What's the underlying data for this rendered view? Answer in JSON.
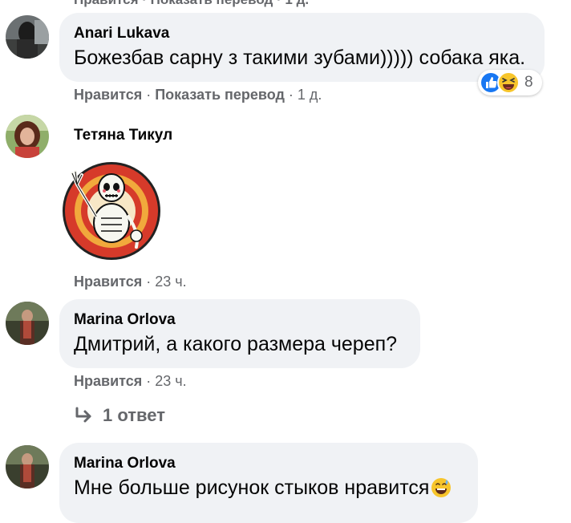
{
  "top_partial": {
    "text": "Нравится · Показать перевод · 1 д."
  },
  "comments": [
    {
      "author": "Anari Lukava",
      "text": "Божезбав сарну з такими зубами))))) собака яка.",
      "actions": {
        "like": "Нравится",
        "translate": "Показать перевод",
        "time": "1 д."
      },
      "reactions": {
        "icons": [
          "like-icon",
          "laughing-emoji-icon"
        ],
        "count": "8"
      }
    },
    {
      "author": "Тетяна Тикул",
      "sticker": "skeleton-sticker",
      "actions": {
        "like": "Нравится",
        "time": "23 ч."
      }
    },
    {
      "author": "Marina Orlova",
      "text": "Дмитрий, а какого размера череп?",
      "actions": {
        "like": "Нравится",
        "time": "23 ч."
      },
      "replies": {
        "icon": "reply-arrow-icon",
        "label": "1 ответ"
      }
    },
    {
      "author": "Marina Orlova",
      "text": "Мне больше рисунок стыков нравится",
      "emoji": "grinning-sweat-emoji-icon"
    }
  ],
  "colors": {
    "bubble": "#f0f2f5",
    "secondary_text": "#65676b",
    "like_blue": "#1877f2",
    "emoji_yellow": "#f7c52b"
  }
}
